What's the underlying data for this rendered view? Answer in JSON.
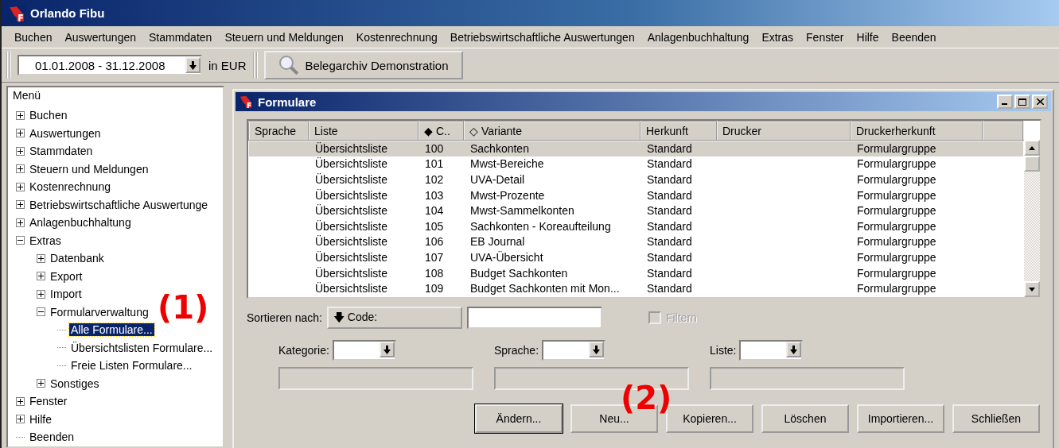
{
  "window": {
    "title": "Orlando Fibu"
  },
  "menu": [
    "Buchen",
    "Auswertungen",
    "Stammdaten",
    "Steuern und Meldungen",
    "Kostenrechnung",
    "Betriebswirtschaftliche Auswertungen",
    "Anlagenbuchhaltung",
    "Extras",
    "Fenster",
    "Hilfe",
    "Beenden"
  ],
  "toolbar": {
    "period": "01.01.2008 - 31.12.2008",
    "currency": "in EUR",
    "archive_button": "Belegarchiv Demonstration"
  },
  "sidebar": {
    "title": "Menü",
    "items": [
      {
        "label": "Buchen",
        "expanded": false,
        "selected": false
      },
      {
        "label": "Auswertungen",
        "expanded": false,
        "selected": false
      },
      {
        "label": "Stammdaten",
        "expanded": false,
        "selected": false
      },
      {
        "label": "Steuern und Meldungen",
        "expanded": false,
        "selected": false
      },
      {
        "label": "Kostenrechnung",
        "expanded": false,
        "selected": false
      },
      {
        "label": "Betriebswirtschaftliche Auswertunge",
        "expanded": false,
        "selected": false
      },
      {
        "label": "Anlagenbuchhaltung",
        "expanded": false,
        "selected": false
      },
      {
        "label": "Extras",
        "expanded": true,
        "selected": false,
        "children": [
          {
            "label": "Datenbank",
            "expanded": false,
            "selected": false
          },
          {
            "label": "Export",
            "expanded": false,
            "selected": false
          },
          {
            "label": "Import",
            "expanded": false,
            "selected": false
          },
          {
            "label": "Formularverwaltung",
            "expanded": true,
            "selected": false,
            "children": [
              {
                "label": "Alle Formulare...",
                "selected": true
              },
              {
                "label": "Übersichtslisten Formulare...",
                "selected": false
              },
              {
                "label": "Freie Listen Formulare...",
                "selected": false
              }
            ]
          },
          {
            "label": "Sonstiges",
            "expanded": false,
            "selected": false
          }
        ]
      },
      {
        "label": "Fenster",
        "expanded": false,
        "selected": false
      },
      {
        "label": "Hilfe",
        "expanded": false,
        "selected": false
      },
      {
        "label": "Beenden",
        "selected": false
      }
    ]
  },
  "dialog": {
    "title": "Formulare",
    "table": {
      "columns": [
        {
          "label": "Sprache"
        },
        {
          "label": "Liste"
        },
        {
          "label": "C..",
          "marker": "◆"
        },
        {
          "label": "Variante",
          "marker": "◇"
        },
        {
          "label": "Herkunft"
        },
        {
          "label": "Drucker"
        },
        {
          "label": "Druckerherkunft"
        }
      ],
      "rows": [
        {
          "cells": [
            "",
            "Übersichtsliste",
            "100",
            "Sachkonten",
            "Standard",
            "",
            "Formulargruppe"
          ],
          "selected": true
        },
        {
          "cells": [
            "",
            "Übersichtsliste",
            "101",
            "Mwst-Bereiche",
            "Standard",
            "",
            "Formulargruppe"
          ],
          "selected": false
        },
        {
          "cells": [
            "",
            "Übersichtsliste",
            "102",
            "UVA-Detail",
            "Standard",
            "",
            "Formulargruppe"
          ],
          "selected": false
        },
        {
          "cells": [
            "",
            "Übersichtsliste",
            "103",
            "Mwst-Prozente",
            "Standard",
            "",
            "Formulargruppe"
          ],
          "selected": false
        },
        {
          "cells": [
            "",
            "Übersichtsliste",
            "104",
            "Mwst-Sammelkonten",
            "Standard",
            "",
            "Formulargruppe"
          ],
          "selected": false
        },
        {
          "cells": [
            "",
            "Übersichtsliste",
            "105",
            "Sachkonten - Koreaufteilung",
            "Standard",
            "",
            "Formulargruppe"
          ],
          "selected": false
        },
        {
          "cells": [
            "",
            "Übersichtsliste",
            "106",
            "EB Journal",
            "Standard",
            "",
            "Formulargruppe"
          ],
          "selected": false
        },
        {
          "cells": [
            "",
            "Übersichtsliste",
            "107",
            "UVA-Übersicht",
            "Standard",
            "",
            "Formulargruppe"
          ],
          "selected": false
        },
        {
          "cells": [
            "",
            "Übersichtsliste",
            "108",
            "Budget Sachkonten",
            "Standard",
            "",
            "Formulargruppe"
          ],
          "selected": false
        },
        {
          "cells": [
            "",
            "Übersichtsliste",
            "109",
            "Budget Sachkonten mit Mon...",
            "Standard",
            "",
            "Formulargruppe"
          ],
          "selected": false
        }
      ]
    },
    "sort": {
      "label": "Sortieren nach:",
      "button": "Code:",
      "arrow": "🡇"
    },
    "filter": {
      "label": "Filtern",
      "checked": false,
      "disabled": true
    },
    "filters": [
      {
        "label": "Kategorie:"
      },
      {
        "label": "Sprache:"
      },
      {
        "label": "Liste:"
      }
    ],
    "buttons": [
      {
        "label": "Ändern...",
        "default": true
      },
      {
        "label": "Neu...",
        "default": false
      },
      {
        "label": "Kopieren...",
        "default": false
      },
      {
        "label": "Löschen",
        "default": false
      },
      {
        "label": "Importieren...",
        "default": false
      },
      {
        "label": "Schließen",
        "default": false
      }
    ]
  },
  "annotations": [
    "(1)",
    "(2)"
  ]
}
